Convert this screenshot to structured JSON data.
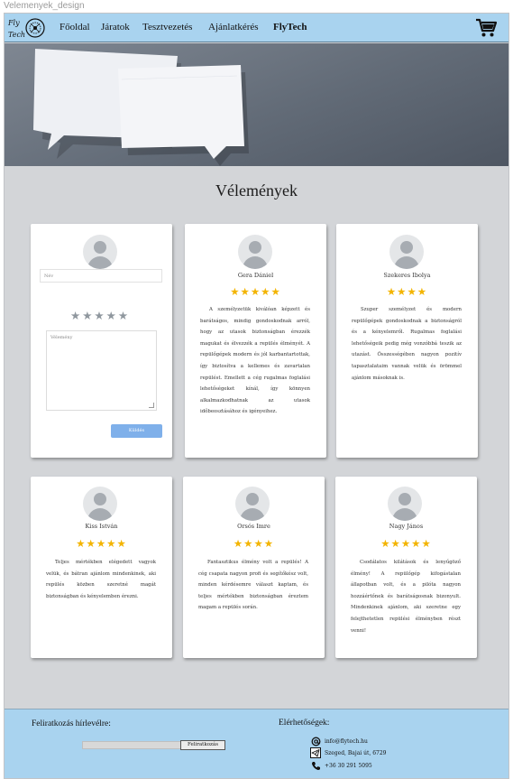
{
  "window_title": "Velemenyek_design",
  "brand": {
    "logo_text_top": "Fly",
    "logo_text_bottom": "Tech"
  },
  "nav": [
    "Főoldal",
    "Járatok",
    "Tesztvezetés",
    "Ajánlatkérés",
    "FlyTech"
  ],
  "page_heading": "Vélemények",
  "form": {
    "name_placeholder": "Név",
    "stars": "★★★★★",
    "text_placeholder": "Vélemény",
    "submit_label": "Küldés"
  },
  "reviews": [
    {
      "name": "Gera Dániel",
      "rating": 5,
      "stars": "★★★★★",
      "text": "A személyzetük kiválóan képzett és barátságos, mindig gondoskodnak arról, hogy az utasok biztonságban érezzék magukat és élvezzék a repülés élményét. A repülőgépek modern és jól karbantartottak, így biztosítva a kellemes és zavartalan repülést. Emellett a cég rugalmas foglalási lehetőségeket kínál, így könnyen alkalmazkodhatnak az utasok időbeosztásához és igényeihez."
    },
    {
      "name": "Szekeres Ibolya",
      "rating": 4,
      "stars": "★★★★",
      "text": "Szuper személyzet és modern repülőgépek gondoskodnak a biztonságról és a kényelemről. Rugalmas foglalási lehetőségeik pedig még vonzóbbá teszik az utazást. Összességében nagyon pozitív tapasztalataim vannak velük és örömmel ajánlom másoknak is."
    },
    {
      "name": "Kiss István",
      "rating": 5,
      "stars": "★★★★★",
      "text": "Teljes mértékben elégedett vagyok velük, és bátran ajánlom mindenkinek, aki repülés közben szeretné magát biztonságban és kényelemben érezni."
    },
    {
      "name": "Orsós Imre",
      "rating": 4,
      "stars": "★★★★",
      "text": "Fantasztikus élmény volt a repülés! A cég csapata nagyon profi és segítőkész volt, minden kérdésemre választ kaptam, és teljes mértékben biztonságban éreztem magam a repülés során."
    },
    {
      "name": "Nagy János",
      "rating": 5,
      "stars": "★★★★★",
      "text": "Csodálatos kilátások és lenyűgöző élmény! A repülőgép kifogástalan állapotban volt, és a pilóta nagyon hozzáértőnek és barátságosnak bizonyult. Mindenkinek ajánlom, aki szeretne egy felejthetetlen repülési élményben részt venni!"
    }
  ],
  "footer": {
    "subscribe_heading": "Feliratkozás hírlevélre:",
    "subscribe_button": "Feliratkozás",
    "contact_heading": "Elérhetőségek:",
    "email": "info@flytech.hu",
    "address": "Szeged, Bajai út, 6729",
    "phone": "+36 30 291 5095"
  },
  "colors": {
    "navbar": "#a9d3ef",
    "background": "#d3d5d8",
    "star": "#f3b400",
    "button": "#7fb0ea"
  },
  "icons": [
    "cart-icon",
    "at-icon",
    "telegram-icon",
    "phone-icon"
  ]
}
